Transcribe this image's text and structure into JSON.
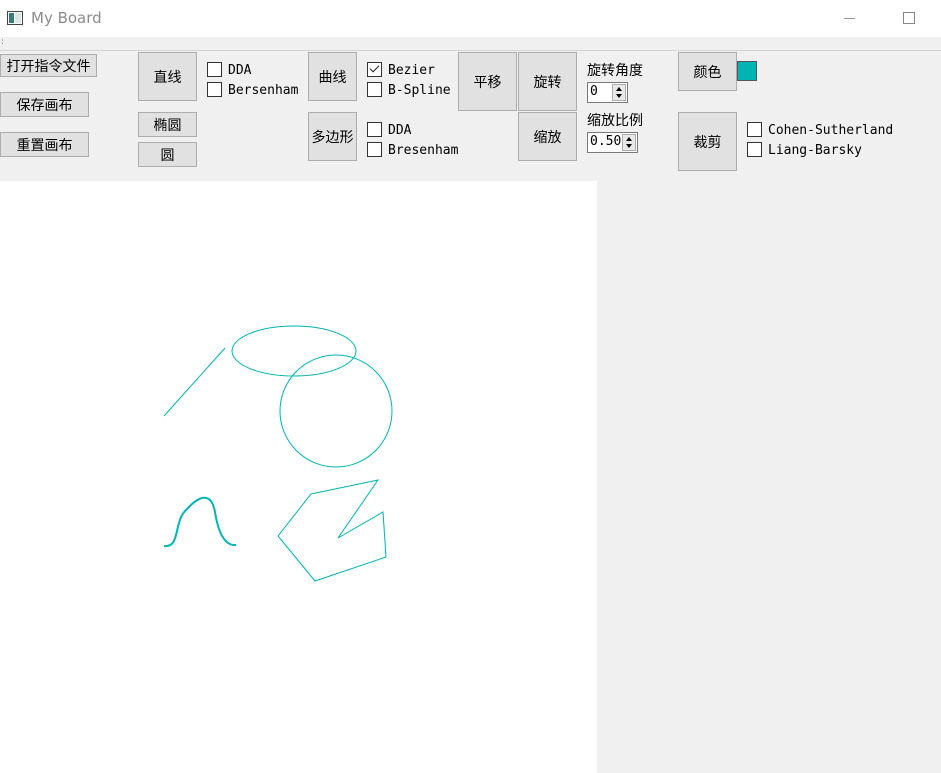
{
  "window": {
    "title": "My Board"
  },
  "file_buttons": {
    "open": "打开指令文件",
    "save": "保存画布",
    "reset": "重置画布"
  },
  "shape_buttons": {
    "line": "直线",
    "ellipse": "椭圆",
    "circle": "圆",
    "curve": "曲线",
    "polygon": "多边形"
  },
  "line_algorithms": [
    "DDA",
    "Bersenham"
  ],
  "curve_algorithms": [
    {
      "label": "Bezier",
      "checked": true
    },
    {
      "label": "B-Spline",
      "checked": false
    }
  ],
  "polygon_algorithms": [
    "DDA",
    "Bresenham"
  ],
  "transform_buttons": {
    "translate": "平移",
    "rotate": "旋转",
    "scale": "缩放"
  },
  "rotate": {
    "label": "旋转角度",
    "value": "0"
  },
  "scale": {
    "label": "缩放比例",
    "value": "0.50"
  },
  "color": {
    "button": "颜色",
    "current": "#00b4b4"
  },
  "clip": {
    "button": "裁剪",
    "algorithms": [
      "Cohen-Sutherland",
      "Liang-Barsky"
    ]
  },
  "icons": {
    "app": "app-icon",
    "minimize": "minimize-icon",
    "maximize": "maximize-icon"
  }
}
